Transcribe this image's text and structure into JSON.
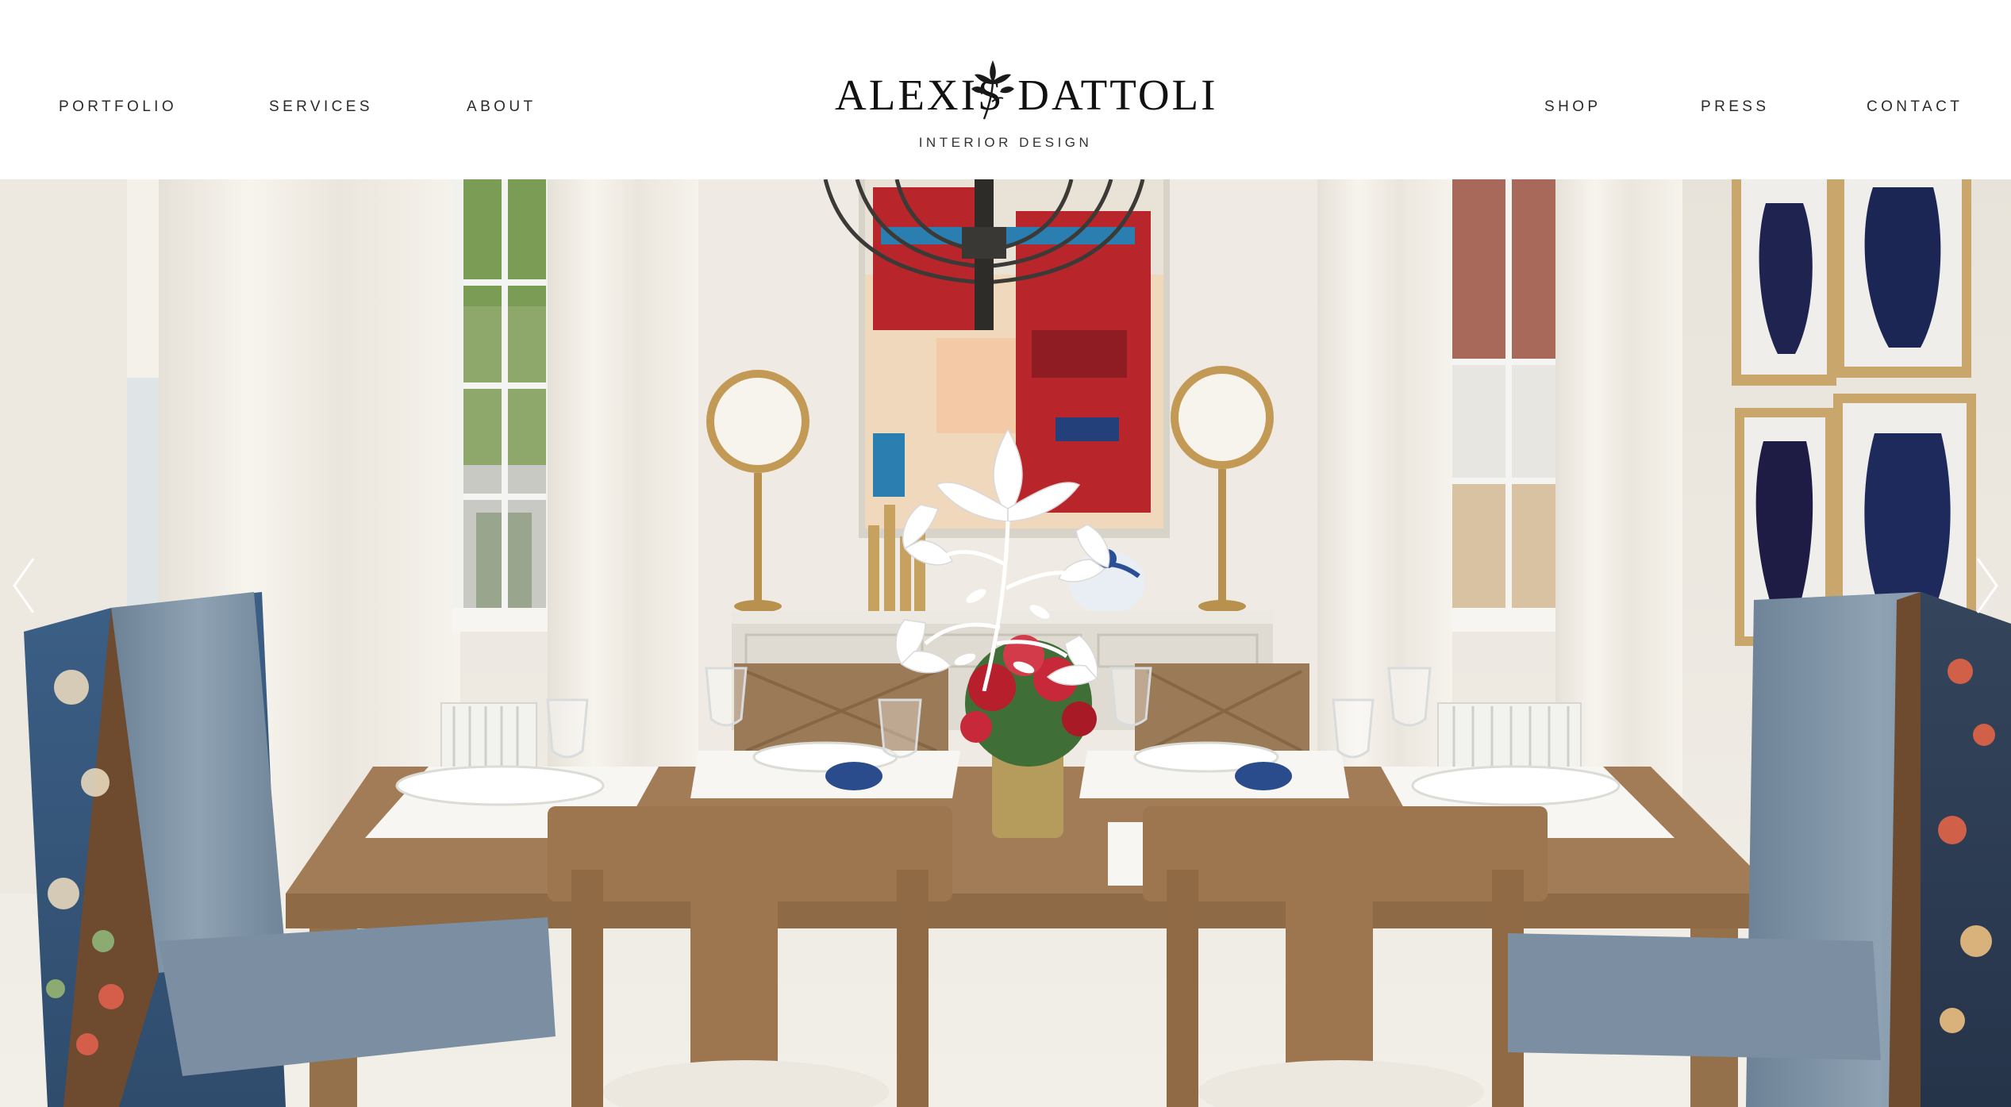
{
  "header": {
    "nav_left": [
      {
        "label": "PORTFOLIO"
      },
      {
        "label": "SERVICES"
      },
      {
        "label": "ABOUT"
      }
    ],
    "nav_right": [
      {
        "label": "SHOP"
      },
      {
        "label": "PRESS"
      },
      {
        "label": "CONTACT"
      }
    ],
    "logo": {
      "name": "ALEXIS DATTOLI",
      "subtitle": "INTERIOR DESIGN",
      "icon": "lotus-flower-icon"
    }
  },
  "hero": {
    "carousel": {
      "prev_icon": "chevron-left-icon",
      "next_icon": "chevron-right-icon"
    },
    "overlay_icon": "lotus-flower-icon",
    "image_subject": "dining-room-photo"
  },
  "colors": {
    "nav_text": "#2b2b2b",
    "logo_text": "#111111",
    "header_bg": "#ffffff",
    "wall": "#ece7df",
    "wood": "#9b7550",
    "chair_blue": "#7e93a6",
    "art_red": "#b8252a",
    "art_blue": "#2a7fb0"
  }
}
